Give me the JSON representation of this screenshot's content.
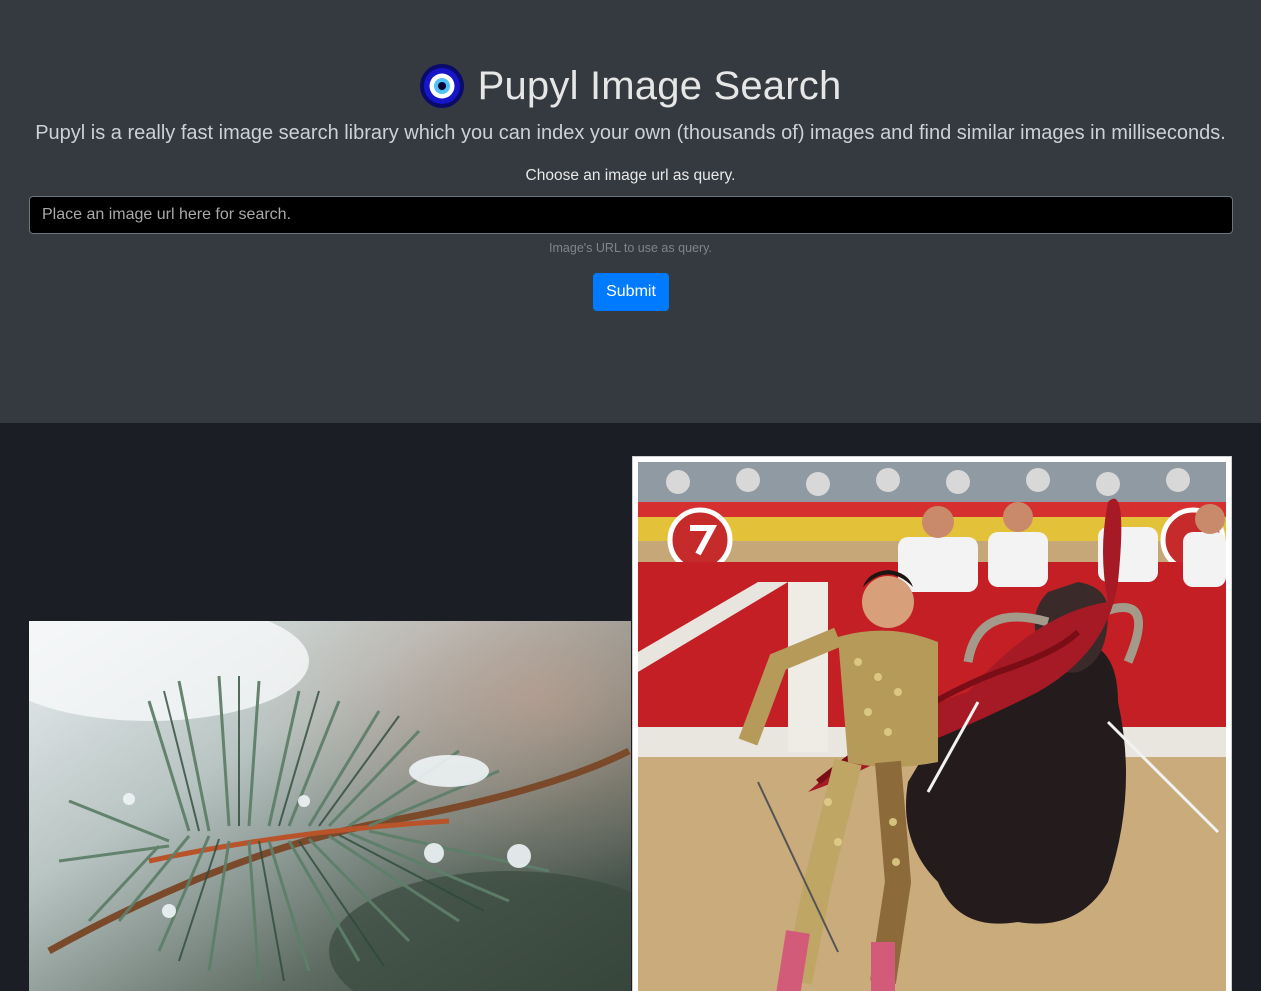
{
  "header": {
    "title": "Pupyl Image Search",
    "logo_icon": "evil-eye-icon",
    "subtitle": "Pupyl is a really fast image search library which you can index your own (thousands of) images and find similar images in milliseconds."
  },
  "search": {
    "label": "Choose an image url as query.",
    "placeholder": "Place an image url here for search.",
    "value": "",
    "help_text": "Image's URL to use as query.",
    "submit_label": "Submit"
  },
  "results": {
    "items": [
      {
        "image": "pine-branch-with-water-droplets-photo"
      },
      {
        "image": "matador-and-bull-photo"
      }
    ]
  },
  "colors": {
    "hero_bg": "#343a40",
    "page_bg": "#1b1e25",
    "accent": "#007bff"
  }
}
